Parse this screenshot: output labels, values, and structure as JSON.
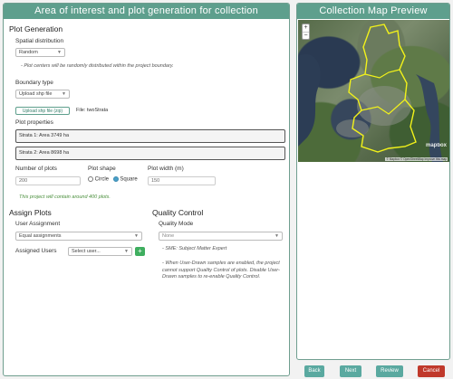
{
  "left_panel": {
    "header": "Area of interest and plot generation for collection",
    "plot_generation": {
      "title": "Plot Generation",
      "spatial_distribution_label": "Spatial distribution",
      "spatial_distribution_value": "Random",
      "spatial_note": "- Plot centers will be randomly distributed within the project boundary.",
      "boundary_type_label": "Boundary type",
      "boundary_type_value": "Upload shp file",
      "upload_button": "Upload shp file (zip)",
      "file_label": "File: twoStrata",
      "plot_properties_label": "Plot properties",
      "strata": [
        "Strata 1: Area 3749 ha",
        "Strata 2: Area 8698 ha"
      ],
      "number_of_plots_label": "Number of plots",
      "number_of_plots_value": "200",
      "plot_shape_label": "Plot shape",
      "shape_circle": "Circle",
      "shape_square": "Square",
      "plot_width_label": "Plot width (m)",
      "plot_width_value": "150",
      "plots_note": "This project will contain around 400 plots."
    },
    "assign_plots": {
      "title": "Assign Plots",
      "user_assignment_label": "User Assignment",
      "user_assignment_value": "Equal assignments",
      "assigned_users_label": "Assigned Users",
      "select_user_placeholder": "Select user...",
      "add_button": "+"
    },
    "quality_control": {
      "title": "Quality Control",
      "quality_mode_label": "Quality Mode",
      "quality_mode_value": "None",
      "sme_note": "- SME: Subject Matter Expert",
      "warning_note": "- When User-Drawn samples are enabled, the project cannot support Quality Control of plots. Disable User-Drawn samples to re-enable Quality Control."
    }
  },
  "right_panel": {
    "header": "Collection Map Preview",
    "zoom_in": "+",
    "zoom_out": "−",
    "map_logo": "mapbox",
    "attribution": "© Mapbox © OpenStreetMap Improve this map"
  },
  "footer": {
    "back": "Back",
    "next": "Next",
    "review": "Review",
    "cancel": "Cancel"
  },
  "colors": {
    "header_bg": "#5e9f8d",
    "footer_teal": "#5aa9a0",
    "cancel_red": "#c0392b",
    "boundary_yellow": "#f2f21a"
  }
}
